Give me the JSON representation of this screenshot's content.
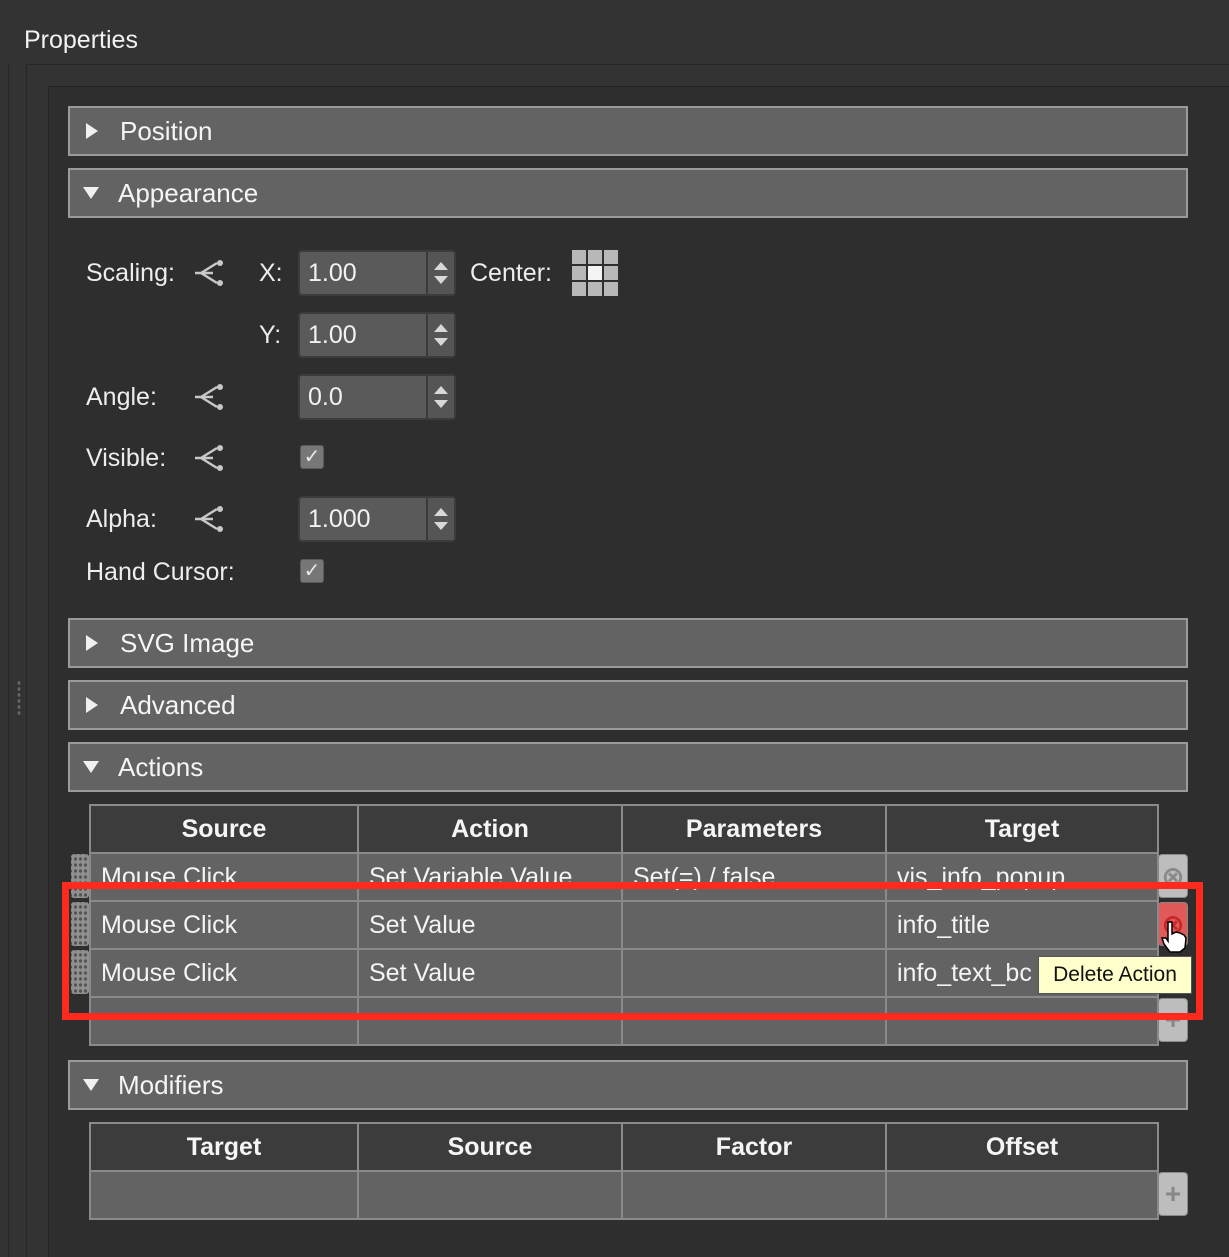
{
  "panel": {
    "title": "Properties"
  },
  "sections": {
    "position": "Position",
    "appearance": "Appearance",
    "svg_image": "SVG Image",
    "advanced": "Advanced",
    "actions": "Actions",
    "modifiers": "Modifiers"
  },
  "appearance": {
    "scaling_label": "Scaling:",
    "x_label": "X:",
    "y_label": "Y:",
    "scale_x": "1.00",
    "scale_y": "1.00",
    "center_label": "Center:",
    "angle_label": "Angle:",
    "angle": "0.0",
    "visible_label": "Visible:",
    "visible": true,
    "alpha_label": "Alpha:",
    "alpha": "1.000",
    "hand_cursor_label": "Hand Cursor:",
    "hand_cursor": true
  },
  "actions_table": {
    "headers": [
      "Source",
      "Action",
      "Parameters",
      "Target"
    ],
    "rows": [
      [
        "Mouse Click",
        "Set Variable Value",
        "Set(=) / false",
        "vis_info_popup"
      ],
      [
        "Mouse Click",
        "Set Value",
        "",
        "info_title"
      ],
      [
        "Mouse Click",
        "Set Value",
        "",
        "info_text_bc"
      ],
      [
        "",
        "",
        "",
        ""
      ]
    ]
  },
  "modifiers_table": {
    "headers": [
      "Target",
      "Source",
      "Factor",
      "Offset"
    ],
    "rows": [
      [
        "",
        "",
        "",
        ""
      ]
    ]
  },
  "tooltip": "Delete Action",
  "colors": {
    "highlight": "#ff2a1e",
    "header_bg": "#636363",
    "panel_bg": "#333333"
  }
}
